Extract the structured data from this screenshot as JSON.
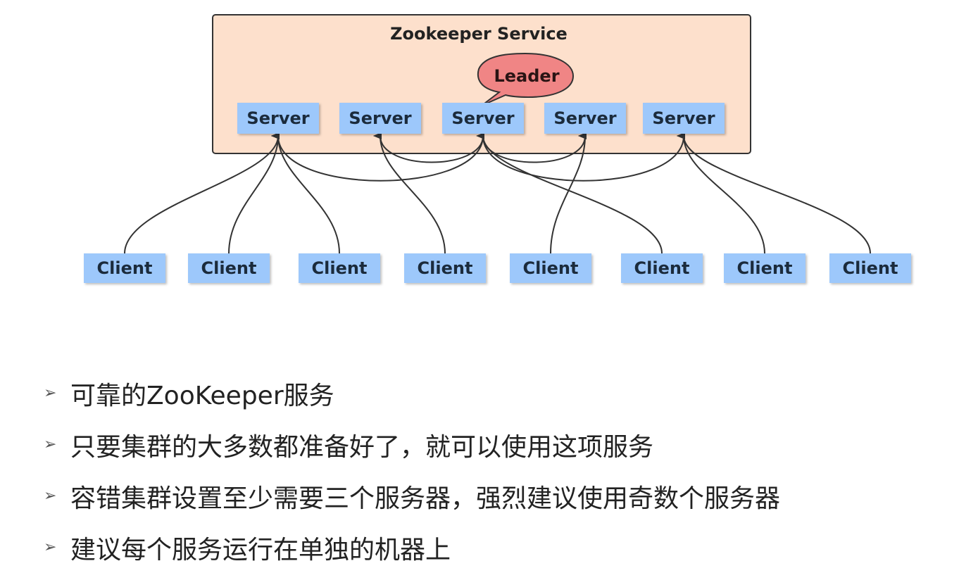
{
  "service": {
    "title": "Zookeeper Service",
    "leader_label": "Leader"
  },
  "servers": [
    {
      "label": "Server"
    },
    {
      "label": "Server"
    },
    {
      "label": "Server"
    },
    {
      "label": "Server"
    },
    {
      "label": "Server"
    }
  ],
  "clients": [
    {
      "label": "Client"
    },
    {
      "label": "Client"
    },
    {
      "label": "Client"
    },
    {
      "label": "Client"
    },
    {
      "label": "Client"
    },
    {
      "label": "Client"
    },
    {
      "label": "Client"
    },
    {
      "label": "Client"
    }
  ],
  "connections": [
    {
      "client": 0,
      "server": 0
    },
    {
      "client": 1,
      "server": 0
    },
    {
      "client": 2,
      "server": 0
    },
    {
      "client": 3,
      "server": 1
    },
    {
      "client": 4,
      "server": 3
    },
    {
      "client": 5,
      "server": 2
    },
    {
      "client": 6,
      "server": 4
    },
    {
      "client": 7,
      "server": 4
    }
  ],
  "colors": {
    "service_fill": "#fde0cc",
    "service_border": "#333333",
    "node_fill": "#9dc8fb",
    "leader_fill": "#f08585",
    "edge": "#333333"
  },
  "bullets": [
    {
      "text": "可靠的ZooKeeper服务"
    },
    {
      "text": "只要集群的大多数都准备好了，就可以使用这项服务"
    },
    {
      "text": "容错集群设置至少需要三个服务器，强烈建议使用奇数个服务器"
    },
    {
      "text": "建议每个服务运行在单独的机器上"
    }
  ],
  "bullet_icon": "arrow-bullet-icon"
}
